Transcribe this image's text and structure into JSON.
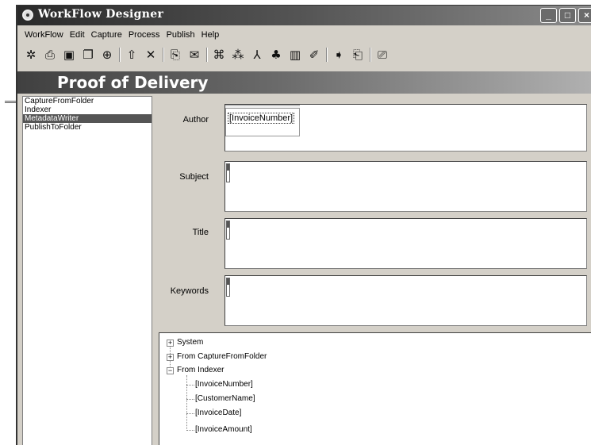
{
  "window": {
    "title": "WorkFlow Designer"
  },
  "title_buttons": {
    "minimize": "_",
    "maximize": "□",
    "close": "×"
  },
  "menu": [
    "WorkFlow",
    "Edit",
    "Capture",
    "Process",
    "Publish",
    "Help"
  ],
  "toolbar": {
    "groups": [
      [
        "new-workflow-icon",
        "print-icon",
        "save-icon",
        "copy-icon",
        "lock-icon"
      ],
      [
        "up-arrow-icon",
        "delete-icon"
      ],
      [
        "scan-icon",
        "email-icon"
      ],
      [
        "capture-folder-icon",
        "ocr-icon",
        "pdf-icon",
        "meta-icon",
        "barcode-icon",
        "tools-icon"
      ],
      [
        "publish-icon",
        "publish-folder-icon"
      ],
      [
        "preview-icon"
      ]
    ],
    "glyphs": {
      "new-workflow-icon": "✲",
      "print-icon": "⎙",
      "save-icon": "▣",
      "copy-icon": "❐",
      "lock-icon": "⊕",
      "up-arrow-icon": "⇧",
      "delete-icon": "✕",
      "scan-icon": "⎘",
      "email-icon": "✉",
      "capture-folder-icon": "⌘",
      "ocr-icon": "⁂",
      "pdf-icon": "⅄",
      "meta-icon": "♣",
      "barcode-icon": "▥",
      "tools-icon": "✐",
      "publish-icon": "➧",
      "publish-folder-icon": "⎗",
      "preview-icon": "⎚"
    }
  },
  "banner": {
    "title": "Proof of Delivery"
  },
  "steps": {
    "items": [
      {
        "label": "CaptureFromFolder",
        "selected": false
      },
      {
        "label": "Indexer",
        "selected": false
      },
      {
        "label": "MetadataWriter",
        "selected": true
      },
      {
        "label": "PublishToFolder",
        "selected": false
      }
    ]
  },
  "fields": {
    "author": {
      "label": "Author",
      "token": "[InvoiceNumber]"
    },
    "subject": {
      "label": "Subject"
    },
    "title": {
      "label": "Title"
    },
    "keywords": {
      "label": "Keywords"
    }
  },
  "tree": {
    "roots": [
      {
        "label": "System",
        "expander": "+"
      },
      {
        "label": "From CaptureFromFolder",
        "expander": "+"
      },
      {
        "label": "From Indexer",
        "expander": "−"
      }
    ],
    "children": [
      "[InvoiceNumber]",
      "[CustomerName]",
      "[InvoiceDate]",
      "[InvoiceAmount]"
    ]
  }
}
